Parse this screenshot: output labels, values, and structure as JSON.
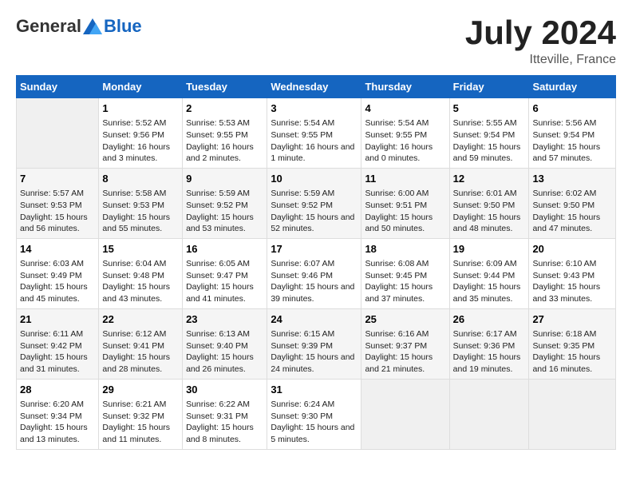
{
  "header": {
    "logo_general": "General",
    "logo_blue": "Blue",
    "title": "July 2024",
    "location": "Itteville, France"
  },
  "days_of_week": [
    "Sunday",
    "Monday",
    "Tuesday",
    "Wednesday",
    "Thursday",
    "Friday",
    "Saturday"
  ],
  "weeks": [
    [
      {
        "day": "",
        "empty": true
      },
      {
        "day": "1",
        "sunrise": "Sunrise: 5:52 AM",
        "sunset": "Sunset: 9:56 PM",
        "daylight": "Daylight: 16 hours and 3 minutes."
      },
      {
        "day": "2",
        "sunrise": "Sunrise: 5:53 AM",
        "sunset": "Sunset: 9:55 PM",
        "daylight": "Daylight: 16 hours and 2 minutes."
      },
      {
        "day": "3",
        "sunrise": "Sunrise: 5:54 AM",
        "sunset": "Sunset: 9:55 PM",
        "daylight": "Daylight: 16 hours and 1 minute."
      },
      {
        "day": "4",
        "sunrise": "Sunrise: 5:54 AM",
        "sunset": "Sunset: 9:55 PM",
        "daylight": "Daylight: 16 hours and 0 minutes."
      },
      {
        "day": "5",
        "sunrise": "Sunrise: 5:55 AM",
        "sunset": "Sunset: 9:54 PM",
        "daylight": "Daylight: 15 hours and 59 minutes."
      },
      {
        "day": "6",
        "sunrise": "Sunrise: 5:56 AM",
        "sunset": "Sunset: 9:54 PM",
        "daylight": "Daylight: 15 hours and 57 minutes."
      }
    ],
    [
      {
        "day": "7",
        "sunrise": "Sunrise: 5:57 AM",
        "sunset": "Sunset: 9:53 PM",
        "daylight": "Daylight: 15 hours and 56 minutes."
      },
      {
        "day": "8",
        "sunrise": "Sunrise: 5:58 AM",
        "sunset": "Sunset: 9:53 PM",
        "daylight": "Daylight: 15 hours and 55 minutes."
      },
      {
        "day": "9",
        "sunrise": "Sunrise: 5:59 AM",
        "sunset": "Sunset: 9:52 PM",
        "daylight": "Daylight: 15 hours and 53 minutes."
      },
      {
        "day": "10",
        "sunrise": "Sunrise: 5:59 AM",
        "sunset": "Sunset: 9:52 PM",
        "daylight": "Daylight: 15 hours and 52 minutes."
      },
      {
        "day": "11",
        "sunrise": "Sunrise: 6:00 AM",
        "sunset": "Sunset: 9:51 PM",
        "daylight": "Daylight: 15 hours and 50 minutes."
      },
      {
        "day": "12",
        "sunrise": "Sunrise: 6:01 AM",
        "sunset": "Sunset: 9:50 PM",
        "daylight": "Daylight: 15 hours and 48 minutes."
      },
      {
        "day": "13",
        "sunrise": "Sunrise: 6:02 AM",
        "sunset": "Sunset: 9:50 PM",
        "daylight": "Daylight: 15 hours and 47 minutes."
      }
    ],
    [
      {
        "day": "14",
        "sunrise": "Sunrise: 6:03 AM",
        "sunset": "Sunset: 9:49 PM",
        "daylight": "Daylight: 15 hours and 45 minutes."
      },
      {
        "day": "15",
        "sunrise": "Sunrise: 6:04 AM",
        "sunset": "Sunset: 9:48 PM",
        "daylight": "Daylight: 15 hours and 43 minutes."
      },
      {
        "day": "16",
        "sunrise": "Sunrise: 6:05 AM",
        "sunset": "Sunset: 9:47 PM",
        "daylight": "Daylight: 15 hours and 41 minutes."
      },
      {
        "day": "17",
        "sunrise": "Sunrise: 6:07 AM",
        "sunset": "Sunset: 9:46 PM",
        "daylight": "Daylight: 15 hours and 39 minutes."
      },
      {
        "day": "18",
        "sunrise": "Sunrise: 6:08 AM",
        "sunset": "Sunset: 9:45 PM",
        "daylight": "Daylight: 15 hours and 37 minutes."
      },
      {
        "day": "19",
        "sunrise": "Sunrise: 6:09 AM",
        "sunset": "Sunset: 9:44 PM",
        "daylight": "Daylight: 15 hours and 35 minutes."
      },
      {
        "day": "20",
        "sunrise": "Sunrise: 6:10 AM",
        "sunset": "Sunset: 9:43 PM",
        "daylight": "Daylight: 15 hours and 33 minutes."
      }
    ],
    [
      {
        "day": "21",
        "sunrise": "Sunrise: 6:11 AM",
        "sunset": "Sunset: 9:42 PM",
        "daylight": "Daylight: 15 hours and 31 minutes."
      },
      {
        "day": "22",
        "sunrise": "Sunrise: 6:12 AM",
        "sunset": "Sunset: 9:41 PM",
        "daylight": "Daylight: 15 hours and 28 minutes."
      },
      {
        "day": "23",
        "sunrise": "Sunrise: 6:13 AM",
        "sunset": "Sunset: 9:40 PM",
        "daylight": "Daylight: 15 hours and 26 minutes."
      },
      {
        "day": "24",
        "sunrise": "Sunrise: 6:15 AM",
        "sunset": "Sunset: 9:39 PM",
        "daylight": "Daylight: 15 hours and 24 minutes."
      },
      {
        "day": "25",
        "sunrise": "Sunrise: 6:16 AM",
        "sunset": "Sunset: 9:37 PM",
        "daylight": "Daylight: 15 hours and 21 minutes."
      },
      {
        "day": "26",
        "sunrise": "Sunrise: 6:17 AM",
        "sunset": "Sunset: 9:36 PM",
        "daylight": "Daylight: 15 hours and 19 minutes."
      },
      {
        "day": "27",
        "sunrise": "Sunrise: 6:18 AM",
        "sunset": "Sunset: 9:35 PM",
        "daylight": "Daylight: 15 hours and 16 minutes."
      }
    ],
    [
      {
        "day": "28",
        "sunrise": "Sunrise: 6:20 AM",
        "sunset": "Sunset: 9:34 PM",
        "daylight": "Daylight: 15 hours and 13 minutes."
      },
      {
        "day": "29",
        "sunrise": "Sunrise: 6:21 AM",
        "sunset": "Sunset: 9:32 PM",
        "daylight": "Daylight: 15 hours and 11 minutes."
      },
      {
        "day": "30",
        "sunrise": "Sunrise: 6:22 AM",
        "sunset": "Sunset: 9:31 PM",
        "daylight": "Daylight: 15 hours and 8 minutes."
      },
      {
        "day": "31",
        "sunrise": "Sunrise: 6:24 AM",
        "sunset": "Sunset: 9:30 PM",
        "daylight": "Daylight: 15 hours and 5 minutes."
      },
      {
        "day": "",
        "empty": true
      },
      {
        "day": "",
        "empty": true
      },
      {
        "day": "",
        "empty": true
      }
    ]
  ]
}
